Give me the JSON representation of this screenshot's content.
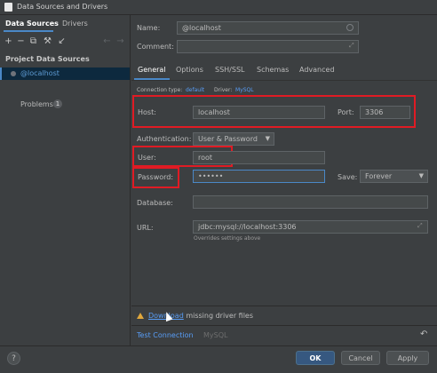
{
  "window": {
    "title": "Data Sources and Drivers"
  },
  "left_panel": {
    "tabs": [
      "Data Sources",
      "Drivers"
    ],
    "toolbar_icons": [
      "add-icon",
      "remove-icon",
      "duplicate-icon",
      "settings-icon",
      "import-icon",
      "back-icon",
      "forward-icon"
    ],
    "section_label": "Project Data Sources",
    "data_sources": [
      {
        "label": "@localhost",
        "selected": true
      }
    ],
    "problems": {
      "label": "Problems",
      "count": "1"
    }
  },
  "form": {
    "name_label": "Name:",
    "name_value": "@localhost",
    "comment_label": "Comment:",
    "tabs": [
      "General",
      "Options",
      "SSH/SSL",
      "Schemas",
      "Advanced"
    ],
    "active_tab": "General",
    "connection_type_label": "Connection type:",
    "connection_type_value": "default",
    "driver_label": "Driver:",
    "driver_value": "MySQL",
    "host_label": "Host:",
    "host_value": "localhost",
    "port_label": "Port:",
    "port_value": "3306",
    "auth_label": "Authentication:",
    "auth_value": "User & Password",
    "user_label": "User:",
    "user_value": "root",
    "password_label": "Password:",
    "password_value": "••••••",
    "save_label": "Save:",
    "save_value": "Forever",
    "database_label": "Database:",
    "url_label": "URL:",
    "url_value": "jdbc:mysql://localhost:3306",
    "url_hint": "Overrides settings above",
    "warning_link": "Download",
    "warning_text": "missing driver files",
    "test_connection": "Test Connection",
    "test_driver": "MySQL"
  },
  "buttons": {
    "help": "?",
    "ok": "OK",
    "cancel": "Cancel",
    "apply": "Apply"
  },
  "colors": {
    "accent": "#4a88c7",
    "link": "#589df6",
    "highlight_box": "#e01b24",
    "warning": "#e0a73c"
  }
}
